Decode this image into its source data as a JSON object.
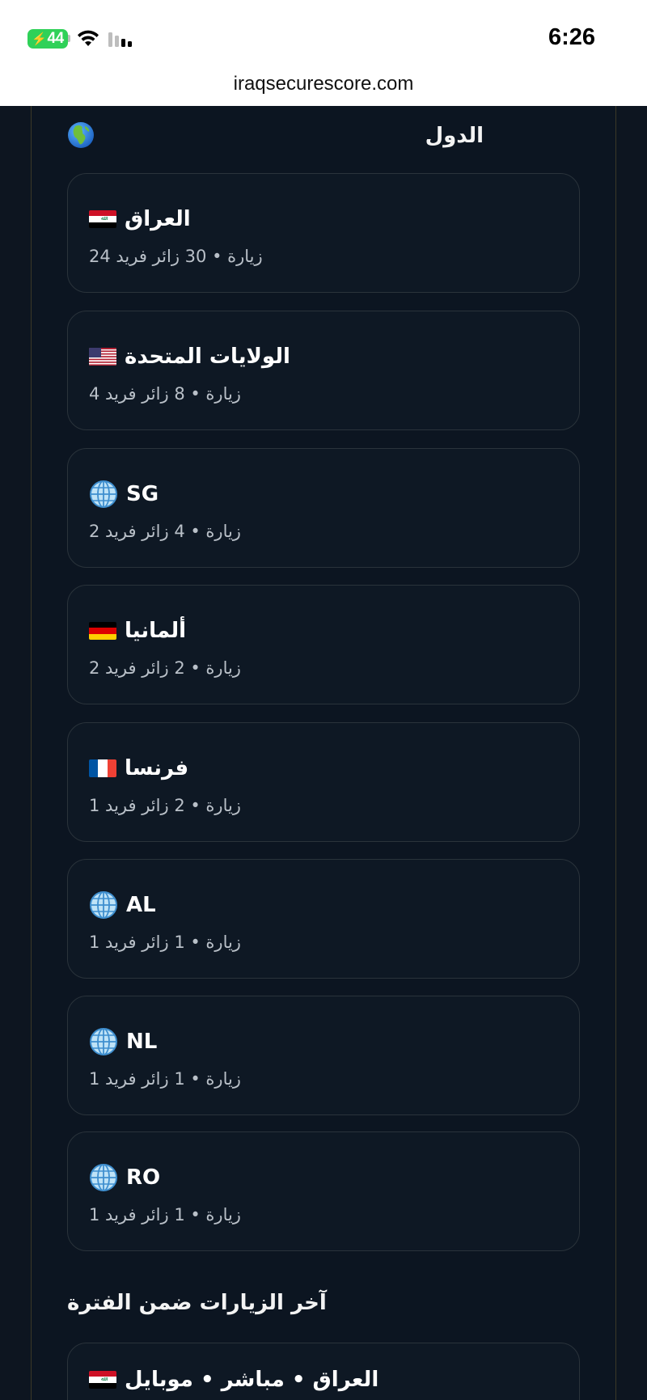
{
  "status_bar": {
    "battery": "44",
    "time": "6:26"
  },
  "url_bar": {
    "url": "iraqsecurescore.com"
  },
  "countries_section": {
    "title": "الدول",
    "icon": "globe-europe-africa-icon"
  },
  "countries": [
    {
      "name": "العراق",
      "subtitle": "24 زيارة • 30 زائر فريد",
      "icon": "flag-iraq-icon"
    },
    {
      "name": "الولايات المتحدة",
      "subtitle": "4 زيارة • 8 زائر فريد",
      "icon": "flag-usa-icon"
    },
    {
      "name": "SG",
      "subtitle": "2 زيارة • 4 زائر فريد",
      "icon": "globe-meridians-icon"
    },
    {
      "name": "ألمانيا",
      "subtitle": "2 زيارة • 2 زائر فريد",
      "icon": "flag-germany-icon"
    },
    {
      "name": "فرنسا",
      "subtitle": "1 زيارة • 2 زائر فريد",
      "icon": "flag-france-icon"
    },
    {
      "name": "AL",
      "subtitle": "1 زيارة • 1 زائر فريد",
      "icon": "globe-meridians-icon"
    },
    {
      "name": "NL",
      "subtitle": "1 زيارة • 1 زائر فريد",
      "icon": "globe-meridians-icon"
    },
    {
      "name": "RO",
      "subtitle": "1 زيارة • 1 زائر فريد",
      "icon": "globe-meridians-icon"
    }
  ],
  "recent_section": {
    "title": "آخر الزيارات ضمن الفترة"
  },
  "recent_visits": [
    {
      "title": "العراق • مباشر • موبايل",
      "icon": "flag-iraq-icon"
    }
  ],
  "colors": {
    "background": "#0c1521",
    "card_border": "#2a333b",
    "panel_border": "#3b3828",
    "subtitle_text": "#b9c0c8"
  }
}
